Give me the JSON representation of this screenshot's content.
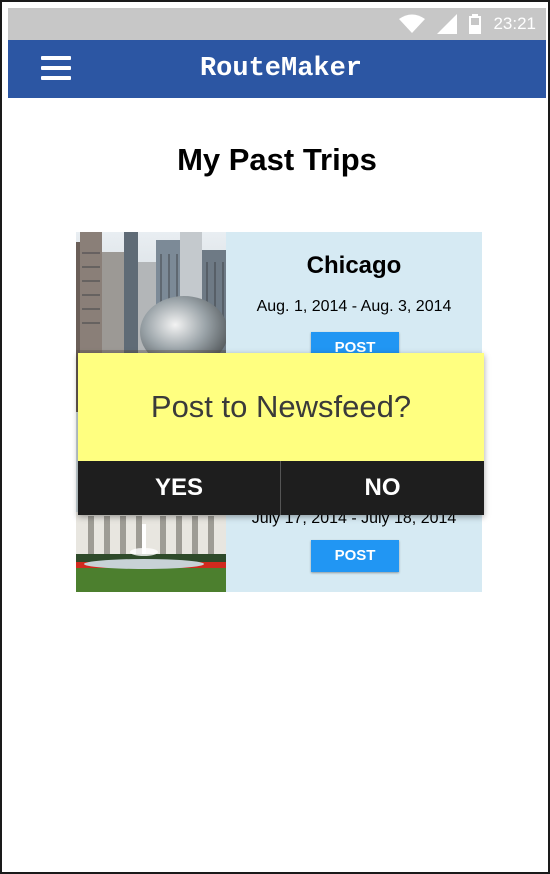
{
  "statusbar": {
    "time": "23:21",
    "icons": [
      "wifi-icon",
      "signal-icon",
      "battery-icon"
    ]
  },
  "appbar": {
    "title": "RouteMaker",
    "menu_icon": "hamburger-menu-icon",
    "color": "#2c56a3"
  },
  "page": {
    "title": "My Past Trips"
  },
  "trips": [
    {
      "city": "Chicago",
      "dates": "Aug. 1, 2014 - Aug. 3, 2014",
      "post_label": "POST",
      "photo": "chicago-skyline-bean-photo"
    },
    {
      "city": "",
      "dates": "July 17, 2014 - July 18, 2014",
      "post_label": "POST",
      "photo": "white-building-fountain-photo"
    }
  ],
  "dialog": {
    "message": "Post to Newsfeed?",
    "yes_label": "YES",
    "no_label": "NO",
    "background": "#ffff80"
  },
  "colors": {
    "accent": "#2196f3",
    "trips_bg": "#d6eaf3",
    "dialog_buttons": "#1e1e1e"
  }
}
